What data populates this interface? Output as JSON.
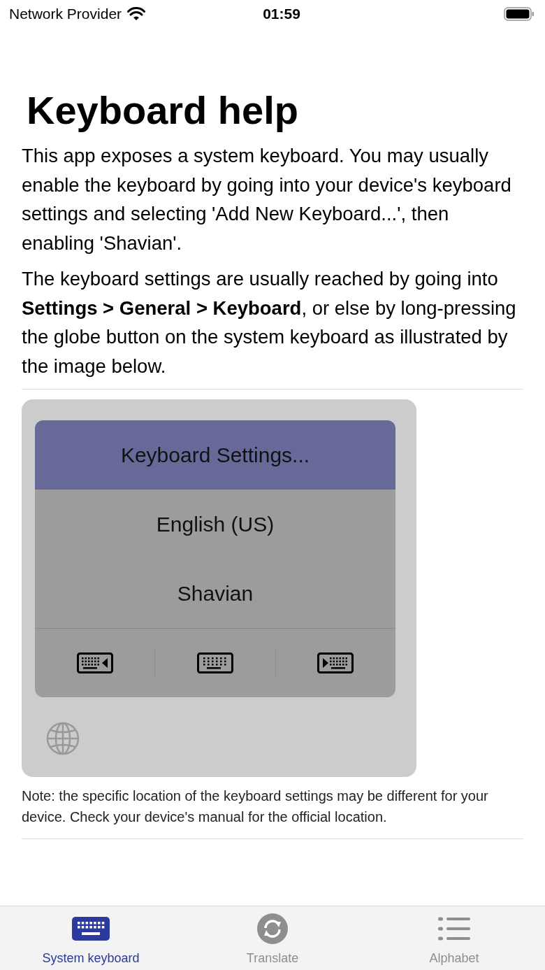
{
  "status_bar": {
    "carrier": "Network Provider",
    "time": "01:59"
  },
  "title": "Keyboard help",
  "paragraphs": [
    "This app exposes a system keyboard. You may usually enable the keyboard by going into your device's keyboard settings and selecting 'Add New Keyboard...', then enabling 'Shavian'.",
    "The keyboard settings are usually reached by going into **Settings > General > Keyboard**, or else by long-pressing the globe button on the system keyboard as illustrated by the image below."
  ],
  "illustration": {
    "menu_items": [
      {
        "label": "Keyboard Settings...",
        "selected": true
      },
      {
        "label": "English (US)",
        "selected": false
      },
      {
        "label": "Shavian",
        "selected": false
      }
    ],
    "layout_buttons": [
      {
        "kind": "left"
      },
      {
        "kind": "center"
      },
      {
        "kind": "right"
      }
    ]
  },
  "note": "Note: the specific location of the keyboard settings may be different for your device. Check your device's manual for the official location.",
  "tabs": [
    {
      "label": "System keyboard",
      "kind": "keyboard",
      "selected": true
    },
    {
      "label": "Translate",
      "kind": "translate",
      "selected": false
    },
    {
      "label": "Alphabet",
      "kind": "list",
      "selected": false
    }
  ]
}
